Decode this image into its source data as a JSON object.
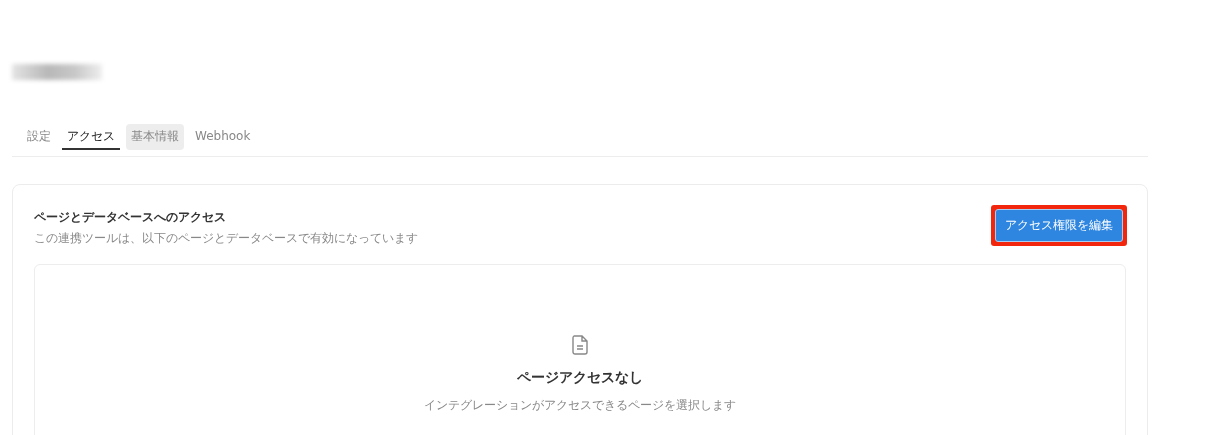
{
  "tabs": [
    {
      "label": "設定",
      "selected": false,
      "hovered": false
    },
    {
      "label": "アクセス",
      "selected": true,
      "hovered": false
    },
    {
      "label": "基本情報",
      "selected": false,
      "hovered": true
    },
    {
      "label": "Webhook",
      "selected": false,
      "hovered": false
    }
  ],
  "access_card": {
    "title": "ページとデータベースへのアクセス",
    "description": "この連携ツールは、以下のページとデータベースで有効になっています",
    "edit_button": {
      "label": "アクセス権限を編集",
      "highlighted": true
    },
    "empty_state": {
      "title": "ページアクセスなし",
      "description": "インテグレーションがアクセスできるページを選択します"
    }
  }
}
